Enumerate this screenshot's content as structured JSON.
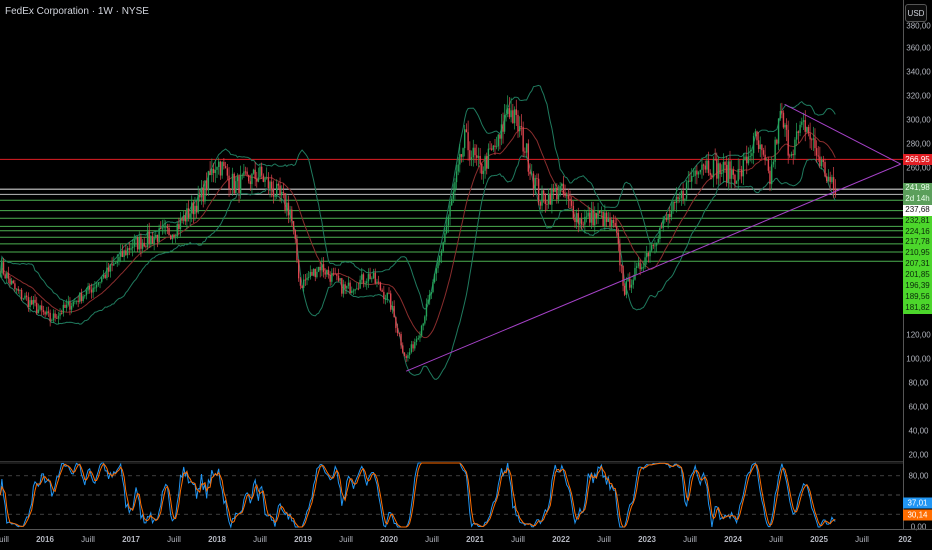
{
  "header": {
    "title": "FedEx Corporation · 1W · NYSE",
    "currency_button": "USD"
  },
  "colors": {
    "up": "#26a65b",
    "down": "#e0454f",
    "band": "#1f7a5e",
    "basis": "#8a2d2d",
    "trend": "#a642c8",
    "resistance": "#e01e24",
    "support": "#4cd62b",
    "k": "#2196f3",
    "d": "#ff6d00"
  },
  "price_axis": {
    "labels": [
      "380,00",
      "360,00",
      "340,00",
      "320,00",
      "300,00",
      "280,00",
      "260,00",
      "120,00",
      "100,00",
      "80,00",
      "60,00",
      "40,00",
      "20,00"
    ],
    "values": [
      380,
      360,
      340,
      320,
      300,
      280,
      260,
      120,
      100,
      80,
      60,
      40,
      20
    ]
  },
  "rsi_axis": {
    "labels": [
      "80,00",
      "0,00"
    ],
    "values": [
      80,
      0
    ],
    "k_value": "37,01",
    "d_value": "30,14",
    "k": 37.01,
    "d": 30.14
  },
  "resistance": {
    "label": "266,95",
    "price": 266.95
  },
  "current": {
    "label": "241,98",
    "countdown": "2d 14h",
    "price": 241.98
  },
  "supports": [
    {
      "label": "237,68",
      "price": 237.68,
      "style": "w"
    },
    {
      "label": "232,81",
      "price": 232.81
    },
    {
      "label": "224,16",
      "price": 224.16
    },
    {
      "label": "217,78",
      "price": 217.78
    },
    {
      "label": "210,95",
      "price": 210.95
    },
    {
      "label": "207,31",
      "price": 207.31
    },
    {
      "label": "201,85",
      "price": 201.85
    },
    {
      "label": "196,39",
      "price": 196.39
    },
    {
      "label": "189,56",
      "price": 189.56
    },
    {
      "label": "181,82",
      "price": 181.82
    }
  ],
  "time_axis": [
    {
      "label": "Juill",
      "t": 2015.5
    },
    {
      "label": "2016",
      "t": 2016
    },
    {
      "label": "Juill",
      "t": 2016.5
    },
    {
      "label": "2017",
      "t": 2017
    },
    {
      "label": "Juill",
      "t": 2017.5
    },
    {
      "label": "2018",
      "t": 2018
    },
    {
      "label": "Juill",
      "t": 2018.5
    },
    {
      "label": "2019",
      "t": 2019
    },
    {
      "label": "Juill",
      "t": 2019.5
    },
    {
      "label": "2020",
      "t": 2020
    },
    {
      "label": "Juill",
      "t": 2020.5
    },
    {
      "label": "2021",
      "t": 2021
    },
    {
      "label": "Juill",
      "t": 2021.5
    },
    {
      "label": "2022",
      "t": 2022
    },
    {
      "label": "Juill",
      "t": 2022.5
    },
    {
      "label": "2023",
      "t": 2023
    },
    {
      "label": "Juill",
      "t": 2023.5
    },
    {
      "label": "2024",
      "t": 2024
    },
    {
      "label": "Juill",
      "t": 2024.5
    },
    {
      "label": "2025",
      "t": 2025
    },
    {
      "label": "Juill",
      "t": 2025.5
    },
    {
      "label": "202",
      "t": 2026
    }
  ],
  "chart_data": {
    "type": "candlestick",
    "title": "FedEx Corporation · 1W · NYSE",
    "ylim": [
      0,
      380
    ],
    "closes": [
      [
        2015.48,
        178
      ],
      [
        2015.65,
        158
      ],
      [
        2016.06,
        133
      ],
      [
        2016.52,
        158
      ],
      [
        2016.76,
        175
      ],
      [
        2017.0,
        195
      ],
      [
        2017.5,
        208
      ],
      [
        2017.8,
        233
      ],
      [
        2018.0,
        266
      ],
      [
        2018.2,
        245
      ],
      [
        2018.5,
        254
      ],
      [
        2018.85,
        225
      ],
      [
        2018.97,
        162
      ],
      [
        2019.2,
        178
      ],
      [
        2019.49,
        158
      ],
      [
        2019.78,
        170
      ],
      [
        2020.0,
        150
      ],
      [
        2020.2,
        100
      ],
      [
        2020.36,
        124
      ],
      [
        2020.53,
        166
      ],
      [
        2020.71,
        225
      ],
      [
        2020.88,
        283
      ],
      [
        2021.06,
        258
      ],
      [
        2021.29,
        283
      ],
      [
        2021.38,
        312
      ],
      [
        2021.52,
        291
      ],
      [
        2021.76,
        233
      ],
      [
        2021.99,
        241
      ],
      [
        2022.22,
        216
      ],
      [
        2022.45,
        220
      ],
      [
        2022.63,
        208
      ],
      [
        2022.74,
        158
      ],
      [
        2022.92,
        178
      ],
      [
        2023.15,
        208
      ],
      [
        2023.38,
        233
      ],
      [
        2023.62,
        266
      ],
      [
        2023.85,
        258
      ],
      [
        2024.08,
        254
      ],
      [
        2024.26,
        283
      ],
      [
        2024.43,
        250
      ],
      [
        2024.55,
        304
      ],
      [
        2024.66,
        275
      ],
      [
        2024.84,
        296
      ],
      [
        2025.01,
        266
      ],
      [
        2025.19,
        237.68
      ]
    ],
    "trendlines": [
      {
        "from": [
          2020.2,
          90
        ],
        "to": [
          2025.95,
          263
        ]
      },
      {
        "from": [
          2024.6,
          313
        ],
        "to": [
          2025.95,
          263
        ]
      }
    ],
    "indicators": [
      "Bollinger Bands 20,2",
      "Stochastic RSI 14,14,3,3"
    ]
  }
}
